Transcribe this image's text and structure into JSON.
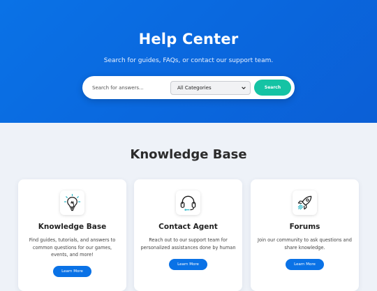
{
  "hero": {
    "title": "Help Center",
    "subtitle": "Search for guides, FAQs, or contact our support team.",
    "colors": {
      "gradient_start": "#0a72e6",
      "gradient_end": "#0b5fd6"
    }
  },
  "search": {
    "placeholder": "Search for answers...",
    "category_selected": "All Categories",
    "button_label": "Search",
    "button_color": "#15c3a4"
  },
  "main": {
    "section_title": "Knowledge Base",
    "cards": [
      {
        "icon": "lightbulb-icon",
        "title": "Knowledge Base",
        "description": "Find guides, tutorials, and answers to common questions for our games, events, and more!",
        "button_label": "Learn More"
      },
      {
        "icon": "headset-icon",
        "title": "Contact Agent",
        "description": "Reach out to our support team for personalized assistances done by human",
        "button_label": "Learn More"
      },
      {
        "icon": "rocket-icon",
        "title": "Forums",
        "description": "Join our community to ask questions and share knowledge.",
        "button_label": "Learn More"
      }
    ],
    "button_color": "#0a72e6"
  }
}
